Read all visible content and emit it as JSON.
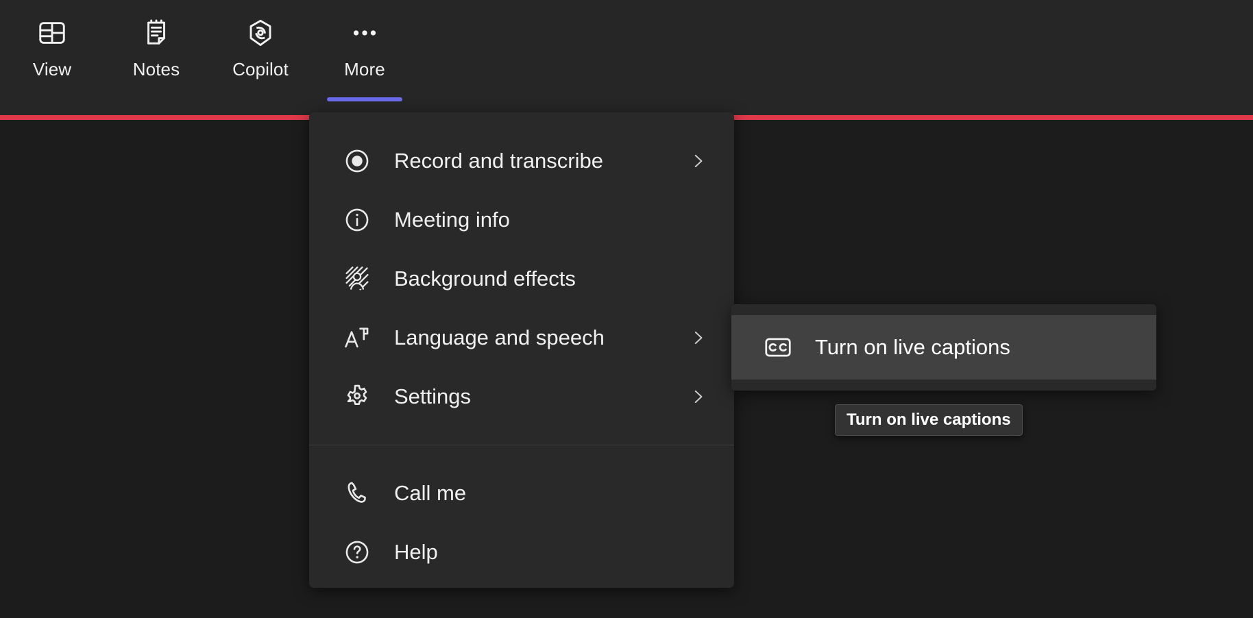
{
  "colors": {
    "app_background": "#1c1c1c",
    "toolbar_background": "#262626",
    "menu_background": "#292929",
    "submenu_highlight": "#414141",
    "active_tab_underline": "#6b6bea",
    "alert_bar_red": "#e0394a",
    "tooltip_background": "#333333",
    "text_primary": "#f0f0f0"
  },
  "toolbar": {
    "items": [
      {
        "label": "View",
        "icon": "view-grid-icon",
        "active": false
      },
      {
        "label": "Notes",
        "icon": "notes-icon",
        "active": false
      },
      {
        "label": "Copilot",
        "icon": "copilot-icon",
        "active": false
      },
      {
        "label": "More",
        "icon": "more-dots-icon",
        "active": true
      }
    ]
  },
  "alert_bar": {
    "visible": true
  },
  "context_menu": {
    "groups": [
      {
        "items": [
          {
            "label": "Record and transcribe",
            "icon": "record-circle-icon",
            "has_submenu": true,
            "chevron": "chevron-right-icon"
          },
          {
            "label": "Meeting info",
            "icon": "info-circle-icon",
            "has_submenu": false,
            "chevron": ""
          },
          {
            "label": "Background effects",
            "icon": "background-effects-icon",
            "has_submenu": false,
            "chevron": ""
          },
          {
            "label": "Language and speech",
            "icon": "translate-icon",
            "has_submenu": true,
            "chevron": "chevron-right-icon"
          },
          {
            "label": "Settings",
            "icon": "gear-icon",
            "has_submenu": true,
            "chevron": "chevron-right-icon"
          }
        ]
      },
      {
        "items": [
          {
            "label": "Call me",
            "icon": "phone-icon",
            "has_submenu": false,
            "chevron": ""
          },
          {
            "label": "Help",
            "icon": "question-mark-icon",
            "has_submenu": false,
            "chevron": ""
          }
        ]
      }
    ]
  },
  "submenu": {
    "parent_item": "Language and speech",
    "items": [
      {
        "label": "Turn on live captions",
        "icon": "closed-caption-icon",
        "highlighted": true
      }
    ]
  },
  "tooltip": {
    "text": "Turn on live captions"
  }
}
